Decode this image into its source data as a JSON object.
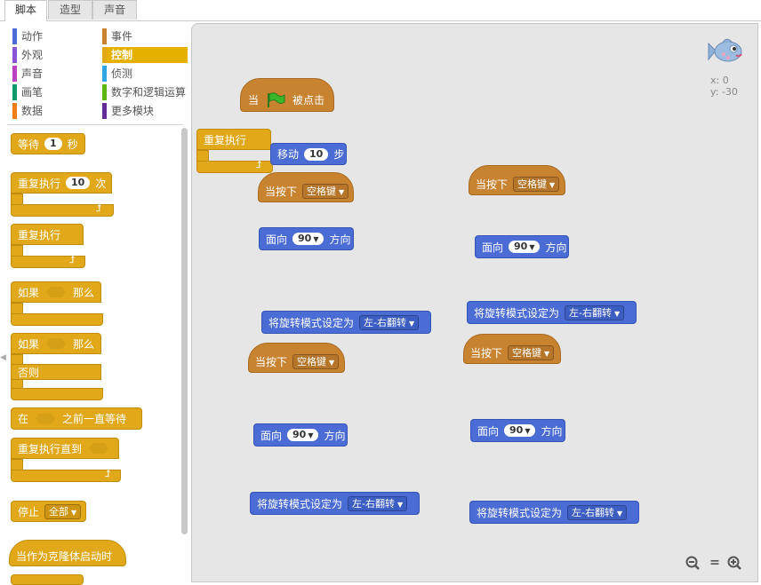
{
  "tabs": [
    {
      "label": "脚本"
    },
    {
      "label": "造型"
    },
    {
      "label": "声音"
    }
  ],
  "categories": {
    "motion": {
      "label": "动作",
      "color": "#4a6cd4"
    },
    "looks": {
      "label": "外观",
      "color": "#8a55d7"
    },
    "sound": {
      "label": "声音",
      "color": "#bb42c3"
    },
    "pen": {
      "label": "画笔",
      "color": "#0e9a6c"
    },
    "data": {
      "label": "数据",
      "color": "#ee7d16"
    },
    "events": {
      "label": "事件",
      "color": "#c88330"
    },
    "control": {
      "label": "控制",
      "color": "#e1a91a"
    },
    "sensing": {
      "label": "侦测",
      "color": "#2ca5e2"
    },
    "operators": {
      "label": "数字和逻辑运算",
      "color": "#5cb712"
    },
    "more": {
      "label": "更多模块",
      "color": "#632d99"
    }
  },
  "palette": {
    "wait": {
      "label": "等待",
      "value": "1",
      "unit": "秒"
    },
    "repeat_n": {
      "label": "重复执行",
      "value": "10",
      "unit": "次"
    },
    "forever": {
      "label": "重复执行"
    },
    "if_then": {
      "label": "如果",
      "then": "那么"
    },
    "if_else": {
      "label": "如果",
      "then": "那么",
      "else": "否则"
    },
    "wait_until": {
      "label": "在",
      "suffix": "之前一直等待"
    },
    "repeat_until": {
      "label": "重复执行直到"
    },
    "stop": {
      "label": "停止",
      "option": "全部"
    },
    "clone_start": {
      "label": "当作为克隆体启动时"
    }
  },
  "script": {
    "green_flag": {
      "when": "当",
      "clicked": "被点击"
    },
    "forever_label": "重复执行",
    "move": {
      "label": "移动",
      "value": "10",
      "unit": "步"
    },
    "key_when": "当按下",
    "key_option": "空格键",
    "point_label": "面向",
    "point_value": "90",
    "point_suffix": "方向",
    "rot_label": "将旋转模式设定为",
    "rot_option": "左-右翻转"
  },
  "stage": {
    "x_label": "x: 0",
    "y_label": "y: -30"
  },
  "zoom": {
    "out": "−",
    "reset": "=",
    "in": "+"
  }
}
